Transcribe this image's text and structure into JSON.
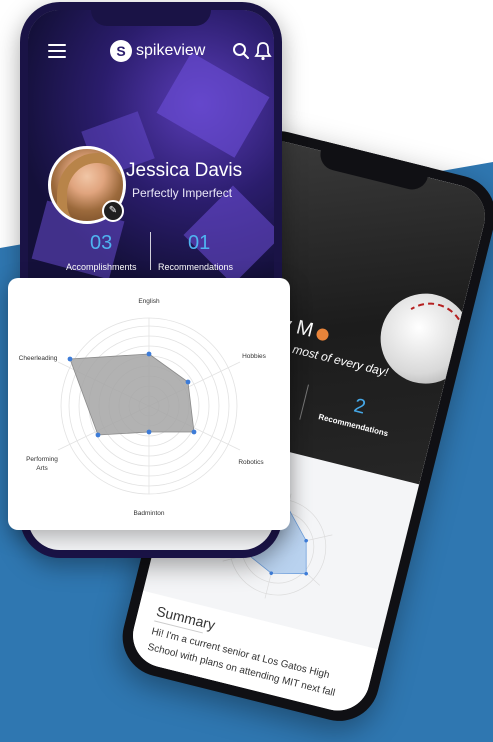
{
  "brand": {
    "name": "spikeview",
    "logo_letter": "S"
  },
  "front_profile": {
    "name": "Jessica Davis",
    "tagline": "Perfectly Imperfect",
    "stats": [
      {
        "value": "03",
        "label": "Accomplishments"
      },
      {
        "value": "01",
        "label": "Recommendations"
      }
    ]
  },
  "radar": {
    "axes": [
      {
        "label": "English"
      },
      {
        "label": "Hobbies"
      },
      {
        "label": "Robotics"
      },
      {
        "label": "Badminton"
      },
      {
        "label": "Performing Arts",
        "lines": [
          "Performing",
          "Arts"
        ]
      },
      {
        "label": "Cheerleading"
      }
    ],
    "fill_color": "#a4a4a4",
    "point_color": "#3d7cd8"
  },
  "back_profile": {
    "name": "Andy M",
    "tagline": "Make the most of every day!",
    "stats": [
      {
        "value": "2",
        "label": "Recommendations"
      }
    ],
    "summary": {
      "title": "Summary",
      "text": "Hi! I'm a current senior at Los Gatos High School with plans on attending MIT next fall"
    }
  },
  "colors": {
    "background_blue": "#2f77b1",
    "accent_blue": "#4fb3f0",
    "front_frame": "#1a1346"
  },
  "icons": [
    "menu-icon",
    "search-icon",
    "bell-icon",
    "edit-icon"
  ]
}
